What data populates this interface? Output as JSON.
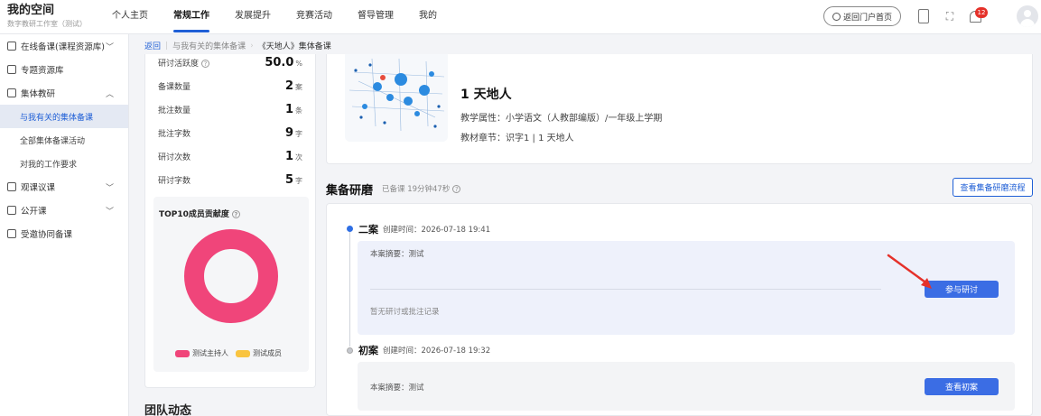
{
  "brand": {
    "title": "我的空间",
    "subtitle": "数字教研工作室（测试）"
  },
  "nav": {
    "items": [
      {
        "label": "个人主页"
      },
      {
        "label": "常规工作"
      },
      {
        "label": "发展提升"
      },
      {
        "label": "竞赛活动"
      },
      {
        "label": "督导管理"
      },
      {
        "label": "我的"
      }
    ],
    "active_index": 1
  },
  "header_right": {
    "portal_label": "返回门户首页",
    "notification_count": "12"
  },
  "sidebar": {
    "items": [
      {
        "label": "在线备课(课程资源库)",
        "chevron": "﹀",
        "icon": "book-icon"
      },
      {
        "label": "专题资源库",
        "chevron": "",
        "icon": "folder-icon"
      },
      {
        "label": "集体教研",
        "chevron": "︿",
        "icon": "doc-icon"
      }
    ],
    "sub_items": [
      {
        "label": "与我有关的集体备课"
      },
      {
        "label": "全部集体备课活动"
      },
      {
        "label": "对我的工作要求"
      }
    ],
    "items_after": [
      {
        "label": "观课议课",
        "chevron": "﹀",
        "icon": "observe-icon"
      },
      {
        "label": "公开课",
        "chevron": "﹀",
        "icon": "screen-icon"
      },
      {
        "label": "受邀协同备课",
        "chevron": "",
        "icon": "group-icon"
      }
    ]
  },
  "breadcrumb": {
    "back": "返回",
    "level1": "与我有关的集体备课",
    "current": "《天地人》集体备课"
  },
  "stats": {
    "rows": [
      {
        "label": "研讨活跃度",
        "value": "50.0",
        "unit": "%"
      },
      {
        "label": "备课数量",
        "value": "2",
        "unit": "案"
      },
      {
        "label": "批注数量",
        "value": "1",
        "unit": "条"
      },
      {
        "label": "批注字数",
        "value": "9",
        "unit": "字"
      },
      {
        "label": "研讨次数",
        "value": "1",
        "unit": "次"
      },
      {
        "label": "研讨字数",
        "value": "5",
        "unit": "字"
      }
    ],
    "contrib_title": "TOP10成员贡献度",
    "legend": [
      {
        "label": "测试主持人",
        "color": "#f0457a"
      },
      {
        "label": "测试成员",
        "color": "#f9c440"
      }
    ],
    "team_title": "团队动态"
  },
  "lesson": {
    "title": "1 天地人",
    "attr": "教学属性：小学语文（人教部编版）/一年级上学期",
    "chapter": "教材章节：识字1 | 1 天地人"
  },
  "section": {
    "title": "集备研磨",
    "meta": "已备课 19分钟47秒",
    "flow_button": "查看集备研磨流程"
  },
  "versions": [
    {
      "name": "二案",
      "time": "创建时间：2026-07-18  19:41",
      "summary": "本案摘要：测试",
      "empty_text": "暂无研讨或批注记录",
      "button": "参与研讨"
    },
    {
      "name": "初案",
      "time": "创建时间：2026-07-18  19:32",
      "summary": "本案摘要：测试",
      "button": "查看初案"
    }
  ],
  "colors": {
    "accent": "#1f5fd6",
    "button": "#3b6de4",
    "donut": "#f0457a",
    "arrow": "#e5312a"
  }
}
